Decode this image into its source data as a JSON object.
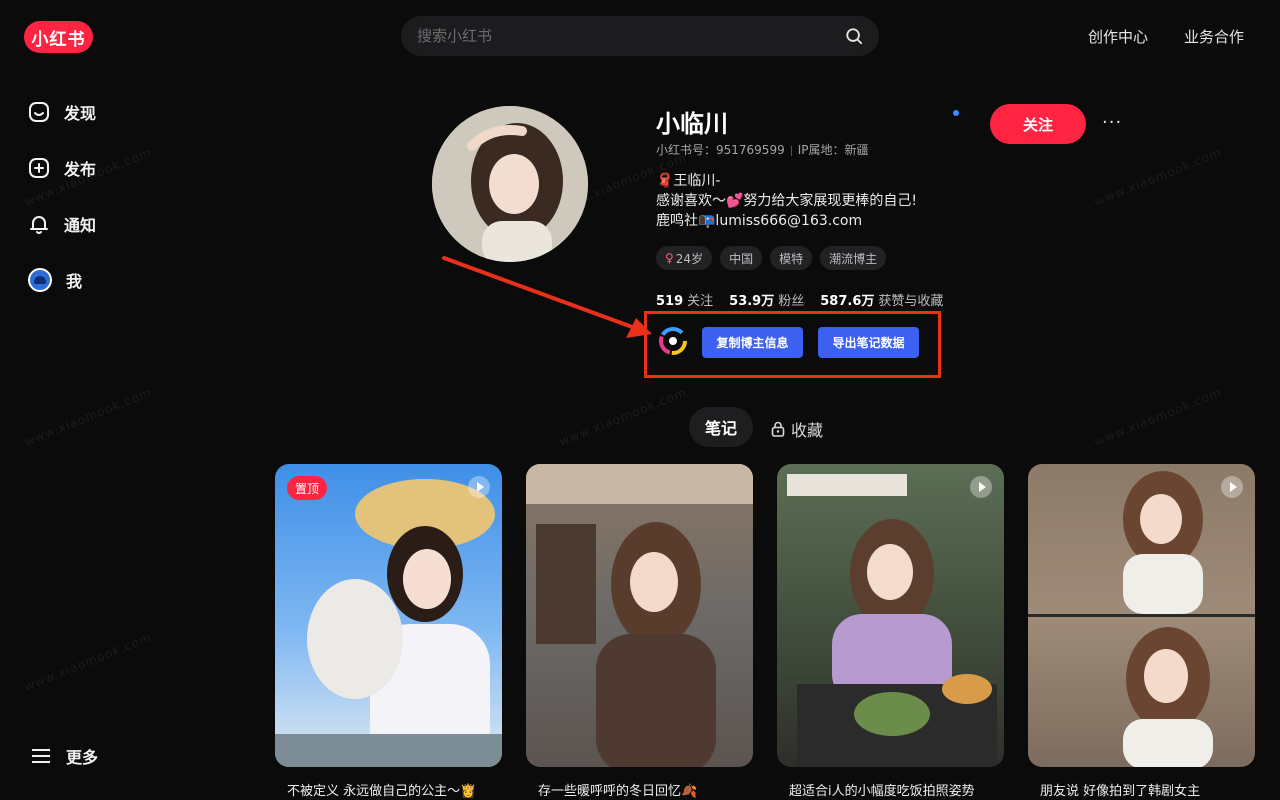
{
  "header": {
    "logo": "小红书",
    "search_placeholder": "搜索小红书",
    "links": [
      "创作中心",
      "业务合作"
    ]
  },
  "sidebar": {
    "items": [
      {
        "label": "发现",
        "icon": "discover-icon"
      },
      {
        "label": "发布",
        "icon": "plus-square-icon"
      },
      {
        "label": "通知",
        "icon": "bell-icon"
      },
      {
        "label": "我",
        "icon": "avatar"
      }
    ],
    "more": "更多"
  },
  "watermark": "www.xiaomook.com",
  "profile": {
    "name": "小临川",
    "id_label": "小红书号：951769599",
    "ip_label": "IP属地：新疆",
    "bio": [
      "🧣王临川-",
      "感谢喜欢～💕努力给大家展现更棒的自己!",
      "鹿鸣社📭lumiss666@163.com"
    ],
    "tags": [
      "24岁",
      "中国",
      "模特",
      "潮流博主"
    ],
    "stats": [
      {
        "value": "519",
        "label": "关注"
      },
      {
        "value": "53.9万",
        "label": "粉丝"
      },
      {
        "value": "587.6万",
        "label": "获赞与收藏"
      }
    ],
    "follow": "关注",
    "more": "···"
  },
  "plugin": {
    "copy_label": "复制博主信息",
    "export_label": "导出笔记数据"
  },
  "tabs": {
    "notes": "笔记",
    "favorites": "收藏"
  },
  "cards": [
    {
      "title": "不被定义 永远做自己的公主～👸",
      "pinned": "置顶"
    },
    {
      "title": "存一些暖呼呼的冬日回忆🍂"
    },
    {
      "title": "超适合i人的小幅度吃饭拍照姿势"
    },
    {
      "title": "朋友说 好像拍到了韩剧女主"
    }
  ],
  "colors": {
    "brand": "#ff2442",
    "plugin_button": "#3c60f0",
    "highlight_box": "#e8301a"
  }
}
